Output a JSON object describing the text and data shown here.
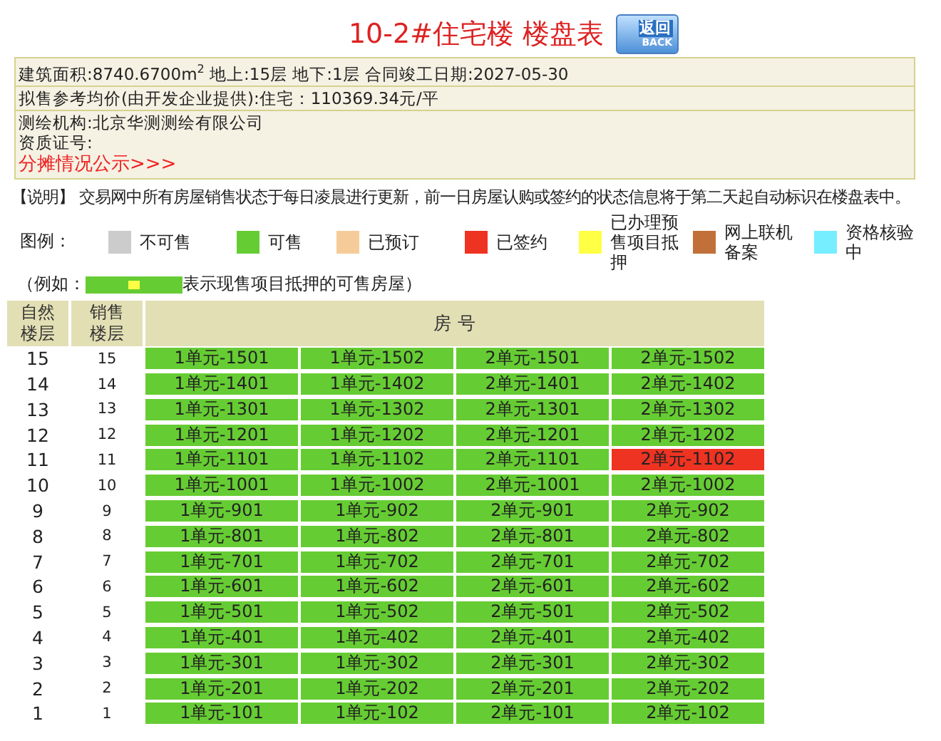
{
  "title": "10-2#住宅楼 楼盘表",
  "back_button": {
    "label": "返回",
    "sublabel": "BACK"
  },
  "info": {
    "rows": [
      "建筑面积:8740.6700m$^{2}$  地上:15层  地下:1层  合同竣工日期:2027-05-30",
      "拟售参考均价(由开发企业提供):住宅：110369.34元/平"
    ],
    "lines": [
      "测绘机构:北京华测测绘有限公司",
      "资质证号:"
    ],
    "link": "分摊情况公示>>>"
  },
  "note": "【说明】 交易网中所有房屋销售状态于每日凌晨进行更新，前一日房屋认购或签约的状态信息将于第二天起自动标识在楼盘表中。",
  "legend": {
    "label": "图例：",
    "items": [
      {
        "label": "不可售",
        "color": "#cccccc"
      },
      {
        "label": "可售",
        "color": "#66cc33"
      },
      {
        "label": "已预订",
        "color": "#f5cc99"
      },
      {
        "label": "已签约",
        "color": "#ee3322"
      },
      {
        "label": "已办理预售项目抵押",
        "color": "#ffff44"
      },
      {
        "label": "网上联机备案",
        "color": "#c07038"
      },
      {
        "label": "资格核验中",
        "color": "#77eeff"
      }
    ]
  },
  "example": {
    "prefix": "（例如：",
    "suffix": "表示现售项目抵押的可售房屋）",
    "swatch": {
      "color": "#66cc33"
    },
    "mark": {
      "color": "#ffff44"
    }
  },
  "table": {
    "columns": [
      "自然楼层",
      "销售楼层",
      "房 号"
    ],
    "rows": [
      {
        "floor": "15",
        "sale_floor": "15",
        "units": [
          {
            "label": "1单元-1501",
            "color": "#66cc33"
          },
          {
            "label": "1单元-1502",
            "color": "#66cc33"
          },
          {
            "label": "2单元-1501",
            "color": "#66cc33"
          },
          {
            "label": "2单元-1502",
            "color": "#66cc33"
          }
        ]
      },
      {
        "floor": "14",
        "sale_floor": "14",
        "units": [
          {
            "label": "1单元-1401",
            "color": "#66cc33"
          },
          {
            "label": "1单元-1402",
            "color": "#66cc33"
          },
          {
            "label": "2单元-1401",
            "color": "#66cc33"
          },
          {
            "label": "2单元-1402",
            "color": "#66cc33"
          }
        ]
      },
      {
        "floor": "13",
        "sale_floor": "13",
        "units": [
          {
            "label": "1单元-1301",
            "color": "#66cc33"
          },
          {
            "label": "1单元-1302",
            "color": "#66cc33"
          },
          {
            "label": "2单元-1301",
            "color": "#66cc33"
          },
          {
            "label": "2单元-1302",
            "color": "#66cc33"
          }
        ]
      },
      {
        "floor": "12",
        "sale_floor": "12",
        "units": [
          {
            "label": "1单元-1201",
            "color": "#66cc33"
          },
          {
            "label": "1单元-1202",
            "color": "#66cc33"
          },
          {
            "label": "2单元-1201",
            "color": "#66cc33"
          },
          {
            "label": "2单元-1202",
            "color": "#66cc33"
          }
        ]
      },
      {
        "floor": "11",
        "sale_floor": "11",
        "units": [
          {
            "label": "1单元-1101",
            "color": "#66cc33"
          },
          {
            "label": "1单元-1102",
            "color": "#66cc33"
          },
          {
            "label": "2单元-1101",
            "color": "#66cc33"
          },
          {
            "label": "2单元-1102",
            "color": "#ee3322"
          }
        ]
      },
      {
        "floor": "10",
        "sale_floor": "10",
        "units": [
          {
            "label": "1单元-1001",
            "color": "#66cc33"
          },
          {
            "label": "1单元-1002",
            "color": "#66cc33"
          },
          {
            "label": "2单元-1001",
            "color": "#66cc33"
          },
          {
            "label": "2单元-1002",
            "color": "#66cc33"
          }
        ]
      },
      {
        "floor": "9",
        "sale_floor": "9",
        "units": [
          {
            "label": "1单元-901",
            "color": "#66cc33"
          },
          {
            "label": "1单元-902",
            "color": "#66cc33"
          },
          {
            "label": "2单元-901",
            "color": "#66cc33"
          },
          {
            "label": "2单元-902",
            "color": "#66cc33"
          }
        ]
      },
      {
        "floor": "8",
        "sale_floor": "8",
        "units": [
          {
            "label": "1单元-801",
            "color": "#66cc33"
          },
          {
            "label": "1单元-802",
            "color": "#66cc33"
          },
          {
            "label": "2单元-801",
            "color": "#66cc33"
          },
          {
            "label": "2单元-802",
            "color": "#66cc33"
          }
        ]
      },
      {
        "floor": "7",
        "sale_floor": "7",
        "units": [
          {
            "label": "1单元-701",
            "color": "#66cc33"
          },
          {
            "label": "1单元-702",
            "color": "#66cc33"
          },
          {
            "label": "2单元-701",
            "color": "#66cc33"
          },
          {
            "label": "2单元-702",
            "color": "#66cc33"
          }
        ]
      },
      {
        "floor": "6",
        "sale_floor": "6",
        "units": [
          {
            "label": "1单元-601",
            "color": "#66cc33"
          },
          {
            "label": "1单元-602",
            "color": "#66cc33"
          },
          {
            "label": "2单元-601",
            "color": "#66cc33"
          },
          {
            "label": "2单元-602",
            "color": "#66cc33"
          }
        ]
      },
      {
        "floor": "5",
        "sale_floor": "5",
        "units": [
          {
            "label": "1单元-501",
            "color": "#66cc33"
          },
          {
            "label": "1单元-502",
            "color": "#66cc33"
          },
          {
            "label": "2单元-501",
            "color": "#66cc33"
          },
          {
            "label": "2单元-502",
            "color": "#66cc33"
          }
        ]
      },
      {
        "floor": "4",
        "sale_floor": "4",
        "units": [
          {
            "label": "1单元-401",
            "color": "#66cc33"
          },
          {
            "label": "1单元-402",
            "color": "#66cc33"
          },
          {
            "label": "2单元-401",
            "color": "#66cc33"
          },
          {
            "label": "2单元-402",
            "color": "#66cc33"
          }
        ]
      },
      {
        "floor": "3",
        "sale_floor": "3",
        "units": [
          {
            "label": "1单元-301",
            "color": "#66cc33"
          },
          {
            "label": "1单元-302",
            "color": "#66cc33"
          },
          {
            "label": "2单元-301",
            "color": "#66cc33"
          },
          {
            "label": "2单元-302",
            "color": "#66cc33"
          }
        ]
      },
      {
        "floor": "2",
        "sale_floor": "2",
        "units": [
          {
            "label": "1单元-201",
            "color": "#66cc33"
          },
          {
            "label": "1单元-202",
            "color": "#66cc33"
          },
          {
            "label": "2单元-201",
            "color": "#66cc33"
          },
          {
            "label": "2单元-202",
            "color": "#66cc33"
          }
        ]
      },
      {
        "floor": "1",
        "sale_floor": "1",
        "units": [
          {
            "label": "1单元-101",
            "color": "#66cc33"
          },
          {
            "label": "1单元-102",
            "color": "#66cc33"
          },
          {
            "label": "2单元-101",
            "color": "#66cc33"
          },
          {
            "label": "2单元-102",
            "color": "#66cc33"
          }
        ]
      }
    ]
  }
}
